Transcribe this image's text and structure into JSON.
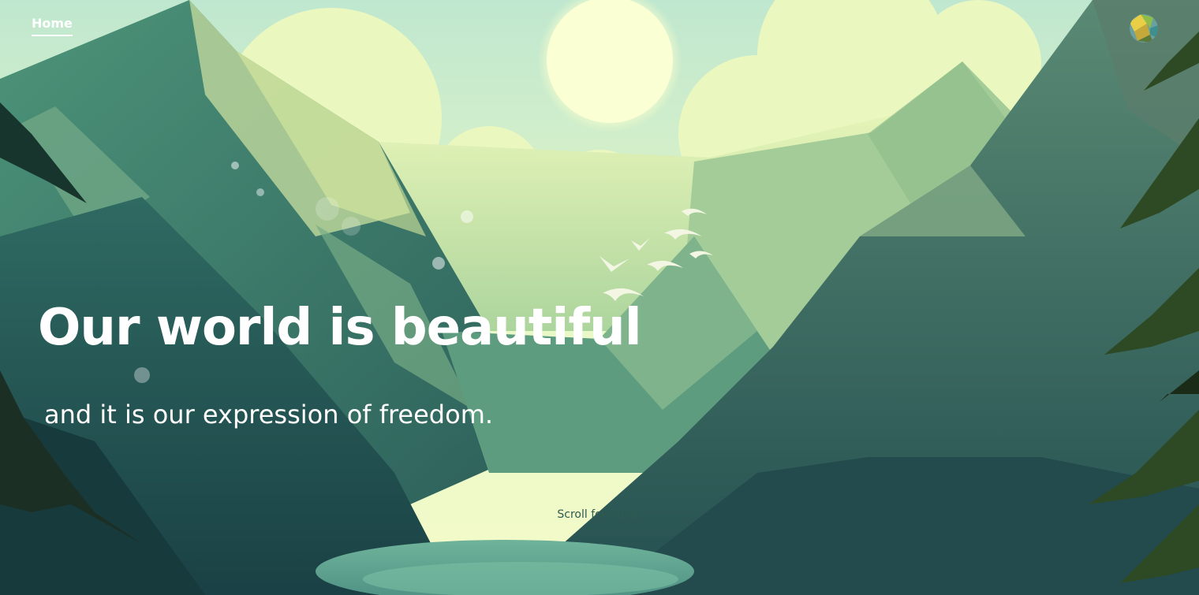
{
  "nav": {
    "home_label": "Home"
  },
  "header": {
    "avatar_icon": "user-avatar"
  },
  "hero": {
    "title": "Our world is beautiful",
    "subtitle": "and it is our expression of freedom.",
    "scroll_hint": "Scroll for more."
  },
  "colors": {
    "sky": "#cdeecb",
    "sun": "#fdffd8",
    "mountain_dark": "#2e5a56",
    "mountain_mid": "#4d8a77",
    "mountain_light": "#a8cf9c",
    "text": "#ffffff"
  }
}
